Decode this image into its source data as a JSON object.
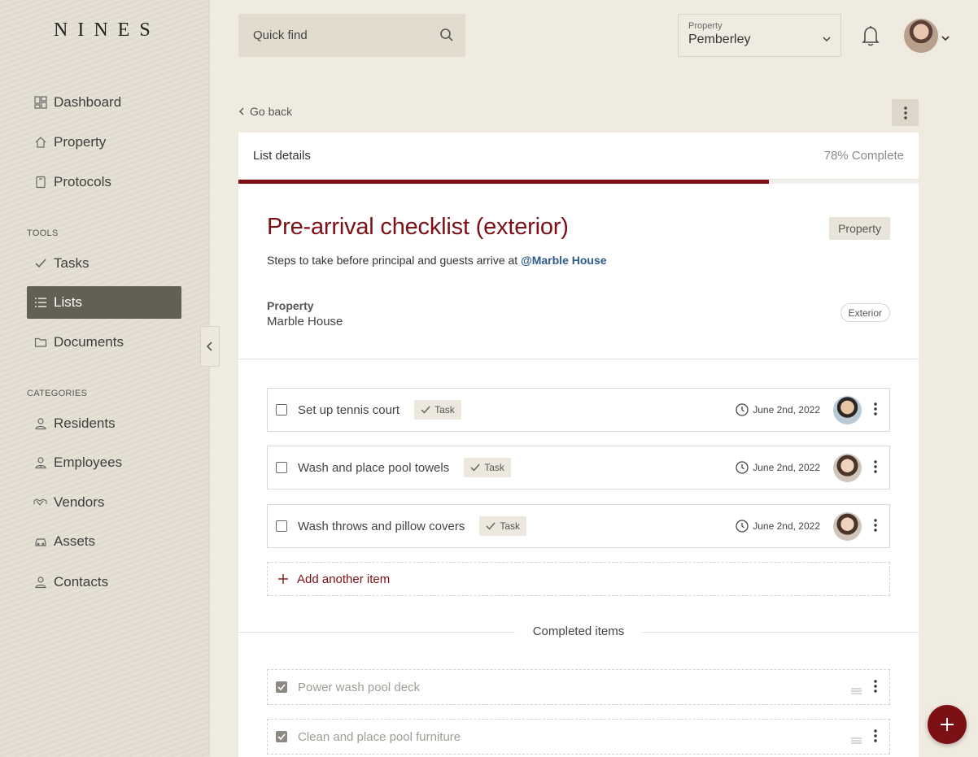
{
  "brand": {
    "logo": "NINES"
  },
  "sidebar": {
    "main_items": [
      {
        "label": "Dashboard",
        "icon": "dashboard-icon"
      },
      {
        "label": "Property",
        "icon": "home-icon"
      },
      {
        "label": "Protocols",
        "icon": "book-icon"
      }
    ],
    "tools_label": "TOOLS",
    "tools_items": [
      {
        "label": "Tasks",
        "icon": "check-icon"
      },
      {
        "label": "Lists",
        "icon": "list-icon",
        "active": true
      },
      {
        "label": "Documents",
        "icon": "folder-icon"
      }
    ],
    "categories_label": "CATEGORIES",
    "categories_items": [
      {
        "label": "Residents",
        "icon": "person-icon"
      },
      {
        "label": "Employees",
        "icon": "employee-icon"
      },
      {
        "label": "Vendors",
        "icon": "handshake-icon"
      },
      {
        "label": "Assets",
        "icon": "car-icon"
      },
      {
        "label": "Contacts",
        "icon": "contacts-icon"
      }
    ]
  },
  "header": {
    "search_placeholder": "Quick find",
    "property_label": "Property",
    "property_value": "Pemberley"
  },
  "content": {
    "go_back": "Go back",
    "card_title": "List details",
    "complete_text": "78% Complete",
    "progress": 0.78,
    "list_title": "Pre-arrival checklist (exterior)",
    "type_tag": "Property",
    "subtitle_prefix": "Steps to take before principal and guests arrive at ",
    "subtitle_mention": "@Marble House",
    "meta_label": "Property",
    "meta_value": "Marble House",
    "area_pill": "Exterior",
    "items": [
      {
        "label": "Set up tennis court",
        "tag": "Task",
        "date": "June 2nd, 2022"
      },
      {
        "label": "Wash and place pool towels",
        "tag": "Task",
        "date": "June 2nd, 2022"
      },
      {
        "label": "Wash throws and pillow covers",
        "tag": "Task",
        "date": "June 2nd, 2022"
      }
    ],
    "add_item": "Add another item",
    "completed_label": "Completed items",
    "completed": [
      {
        "label": "Power wash pool deck"
      },
      {
        "label": "Clean and place pool furniture"
      }
    ]
  },
  "colors": {
    "accent": "#7d1015",
    "mention": "#2e5b8a",
    "sidebar_active": "#625f54"
  }
}
